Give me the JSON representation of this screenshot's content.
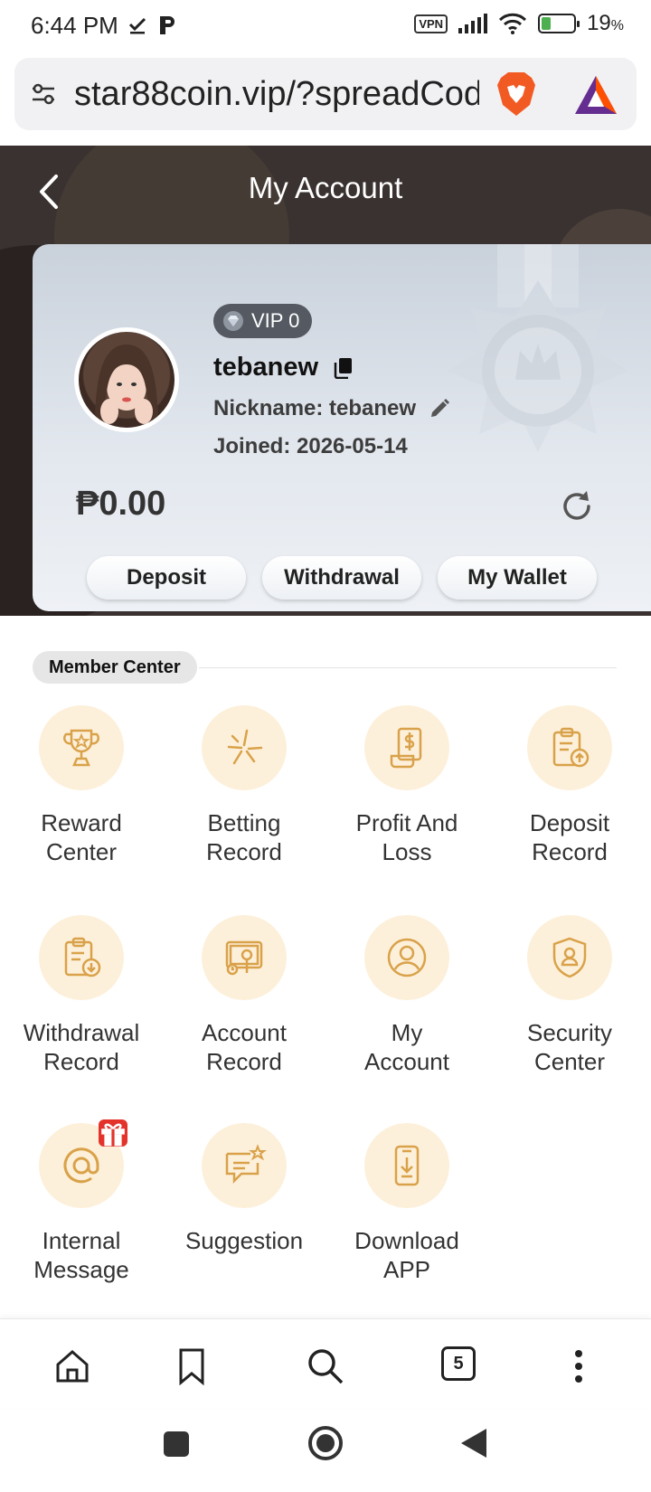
{
  "status": {
    "time": "6:44 PM",
    "vpn": "VPN",
    "battery": "19",
    "battery_unit": "%"
  },
  "browser": {
    "url": "star88coin.vip/?spreadCode",
    "tab_count": "5"
  },
  "header": {
    "title": "My Account"
  },
  "account": {
    "vip_label": "VIP 0",
    "username": "tebanew",
    "nickname": "Nickname: tebanew",
    "joined": "Joined: 2026-05-14",
    "balance": "₱0.00",
    "buttons": {
      "deposit": "Deposit",
      "withdrawal": "Withdrawal",
      "wallet": "My Wallet"
    }
  },
  "member_center": {
    "title": "Member Center",
    "items": [
      {
        "label": "Reward Center",
        "icon": "trophy-icon"
      },
      {
        "label": "Betting Record",
        "icon": "sparkle-icon"
      },
      {
        "label": "Profit And Loss",
        "icon": "receipt-dollar-icon"
      },
      {
        "label": "Deposit Record",
        "icon": "clipboard-upload-icon"
      },
      {
        "label": "Withdrawal Record",
        "icon": "clipboard-download-icon"
      },
      {
        "label": "Account Record",
        "icon": "monitor-chart-icon"
      },
      {
        "label": "My Account",
        "icon": "user-circle-icon"
      },
      {
        "label": "Security Center",
        "icon": "shield-user-icon"
      },
      {
        "label": "Internal Message",
        "icon": "at-sign-icon"
      },
      {
        "label": "Suggestion",
        "icon": "chat-star-icon"
      },
      {
        "label": "Download APP",
        "icon": "phone-download-icon"
      }
    ]
  },
  "colors": {
    "icon_gold": "#d9a24a",
    "icon_bg": "#fdf0da",
    "header_dark": "#3a3230",
    "badge_red": "#e3332b"
  }
}
